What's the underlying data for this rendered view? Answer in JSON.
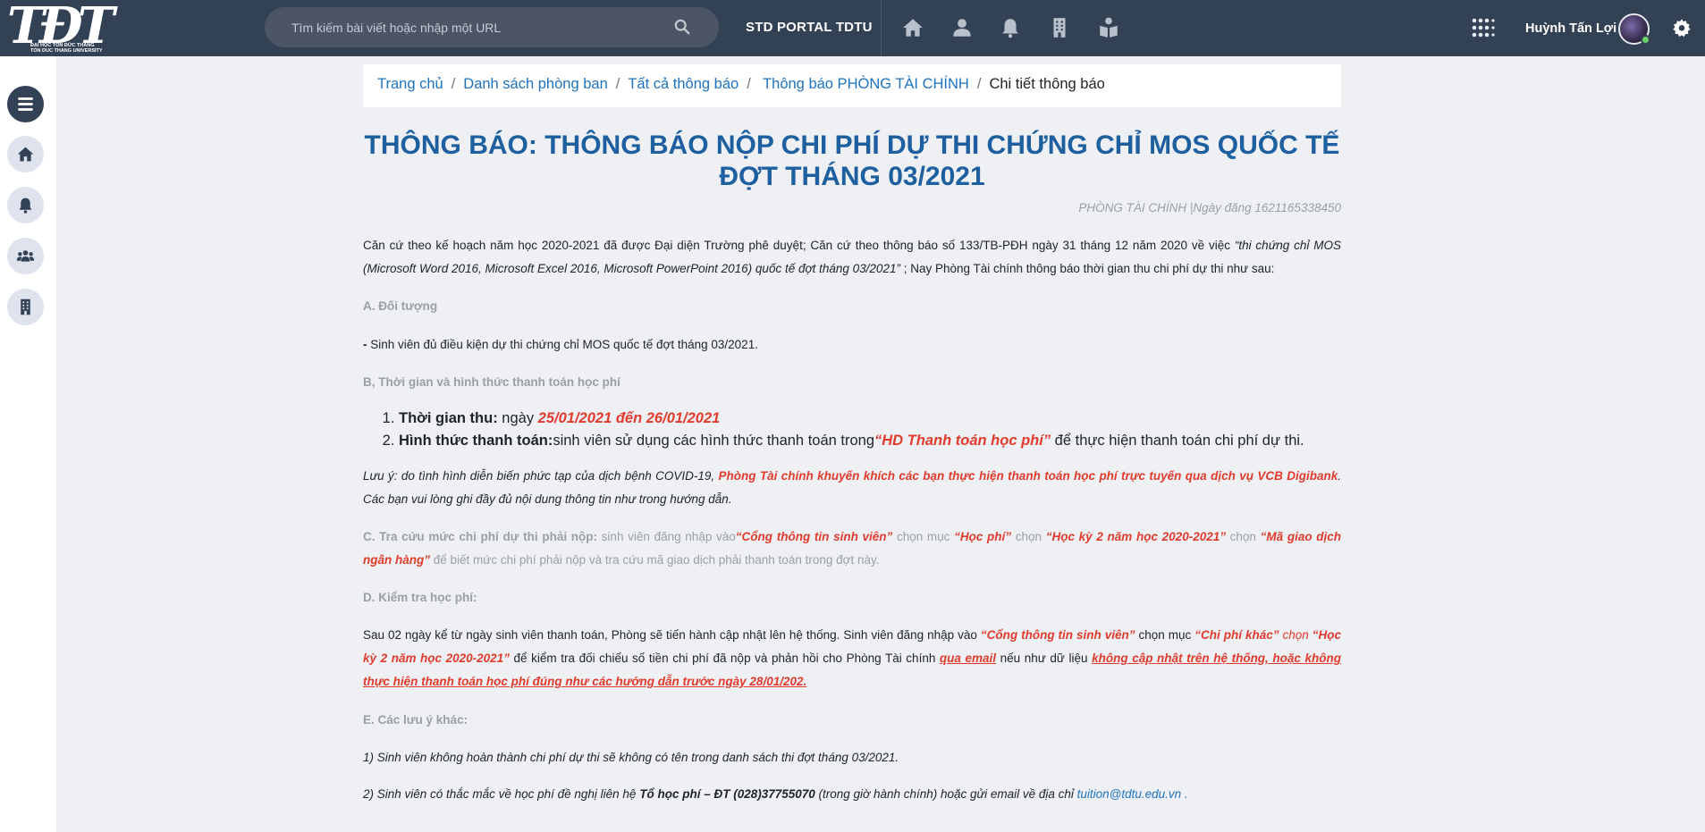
{
  "header": {
    "logo_text": "TĐT",
    "logo_sub_1": "ĐẠI HỌC TÔN ĐỨC THẮNG",
    "logo_sub_2": "TON DUC THANG UNIVERSITY",
    "search_placeholder": "Tìm kiếm bài viết hoặc nhập một URL",
    "portal_label": "STD PORTAL TDTU",
    "username": "Huỳnh Tấn Lợi"
  },
  "sidebar": {
    "items": [
      "menu-icon",
      "home-icon",
      "bell-icon",
      "users-icon",
      "building-icon"
    ]
  },
  "breadcrumb": {
    "items": [
      "Trang chủ",
      "Danh sách phòng ban",
      "Tất cả thông báo",
      "Thông báo PHÒNG TÀI CHÍNH"
    ],
    "current": "Chi tiết thông báo"
  },
  "article": {
    "title_line1": "THÔNG BÁO: THÔNG BÁO NỘP CHI PHÍ DỰ THI CHỨNG CHỈ MOS QUỐC TẾ",
    "title_line2": "ĐỢT THÁNG 03/2021",
    "meta": "PHÒNG TÀI CHÍNH |Ngày đăng 1621165338450",
    "intro_a": "Căn cứ theo kế hoạch năm học 2020-2021 đã được Đại diện Trường phê duyệt; Căn cứ theo thông báo số 133/TB-PĐH ngày 31 tháng 12 năm 2020 về việc ",
    "intro_b": "“thi chứng chỉ MOS (Microsoft Word 2016, Microsoft Excel 2016, Microsoft PowerPoint 2016) quốc tế đợt tháng 03/2021”",
    "intro_c": " ; Nay Phòng Tài chính thông báo thời gian thu chi phí dự thi như sau:",
    "sec_a_heading": "A. Đối tượng",
    "sec_a_dash": "-",
    "sec_a_text": " Sinh viên đủ điều kiện dự thi chứng chỉ MOS quốc tế đợt tháng 03/2021.",
    "sec_b_heading": "B, Thời gian và hình thức thanh toán học phí",
    "list1_label": "Thời gian thu:",
    "list1_text": " ngày ",
    "list1_date": "25/01/2021 đến 26/01/2021",
    "list2_label": "Hình thức thanh toán:",
    "list2_text": "sinh viên sử dụng các hình thức thanh toán trong",
    "list2_quote": "“HD Thanh toán học phí”",
    "list2_end": " để thực hiện thanh toán chi phí dự thi.",
    "note_a": "Lưu ý: do tình hình diễn biến phức tạp của dịch bệnh COVID-19, ",
    "note_b": "Phòng Tài chính khuyến khích các bạn thực hiện thanh toán học phí trực tuyến qua dịch vụ VCB Digibank",
    "note_c": ". Các bạn vui lòng ghi đầy đủ nội dung thông tin như trong hướng dẫn.",
    "sec_c_heading": "C. Tra cứu mức chi phí dự thi phải nộp:",
    "sec_c_1": " sinh viên đăng nhập vào",
    "sec_c_2": "“Cổng thông tin sinh viên”",
    "sec_c_3": " chọn mục ",
    "sec_c_4": "“Học phí”",
    "sec_c_5": " chọn ",
    "sec_c_6": "“Học kỳ 2 năm học 2020-2021”",
    "sec_c_7": " chọn ",
    "sec_c_8": "“Mã giao dịch ngân hàng”",
    "sec_c_9": " để biết mức chi phí phải nộp và tra cứu mã giao dịch phải thanh toán trong đợt này.",
    "sec_d_heading": "D. Kiểm tra học phí:",
    "sec_d_1": "Sau 02 ngày kể từ ngày sinh viên thanh toán, Phòng sẽ tiến hành cập nhật lên hệ thống. Sinh viên đăng nhập vào ",
    "sec_d_2": "“Cổng thông tin sinh viên”",
    "sec_d_3": " chọn mục ",
    "sec_d_4": "“Chi phí khác”",
    "sec_d_5": " chọn ",
    "sec_d_6": "“Học kỳ 2 năm học 2020-2021”",
    "sec_d_7": " để kiểm tra đối chiếu số tiền chi phí đã nộp và phản hồi cho Phòng Tài chính ",
    "sec_d_8": "qua email",
    "sec_d_9": " nếu như dữ liệu ",
    "sec_d_10": "không cập nhật trên hệ thống, hoặc không thực hiện thanh toán học phí đúng như các hướng dẫn trước ngày 28/01/202.",
    "sec_e_heading": "E. Các lưu ý khác:",
    "sec_e_1": "1) Sinh viên không hoàn thành chi phí dự thi sẽ không có tên trong danh sách thi đợt tháng 03/2021.",
    "sec_e_2a": "2) Sinh viên có thắc mắc về học phí đề nghị liên hệ ",
    "sec_e_2b": "Tổ học phí – ĐT (028)37755070",
    "sec_e_2c": " (trong giờ hành chính) hoặc gửi email về địa chỉ ",
    "sec_e_2d": "tuition@tdtu.edu.vn ."
  }
}
